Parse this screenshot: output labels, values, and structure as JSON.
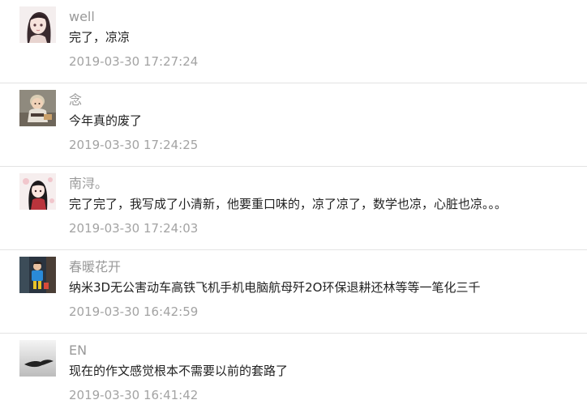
{
  "comments": [
    {
      "username": "well",
      "content": "完了，凉凉",
      "time": "2019-03-30 17:27:24",
      "avatar_icon": "anime-girl-avatar-icon"
    },
    {
      "username": "念",
      "content": "今年真的废了",
      "time": "2019-03-30 17:24:25",
      "avatar_icon": "baby-photo-avatar-icon"
    },
    {
      "username": "南浔。",
      "content": "完了完了，我写成了小清新，他要重口味的，凉了凉了，数学也凉，心脏也凉。。。",
      "time": "2019-03-30 17:24:03",
      "avatar_icon": "illustrated-girl-avatar-icon"
    },
    {
      "username": "春暖花开",
      "content": "纳米3D无公害动车高铁飞机手机电脑航母歼2O环保退耕还林等等一笔化三千",
      "time": "2019-03-30 16:42:59",
      "avatar_icon": "child-photo-avatar-icon"
    },
    {
      "username": "EN",
      "content": "现在的作文感觉根本不需要以前的套路了",
      "time": "2019-03-30 16:41:42",
      "avatar_icon": "bird-silhouette-avatar-icon"
    }
  ],
  "colors": {
    "username": "#999999",
    "content": "#222222",
    "time": "#a3a3a3",
    "divider": "#e3e3e3"
  }
}
